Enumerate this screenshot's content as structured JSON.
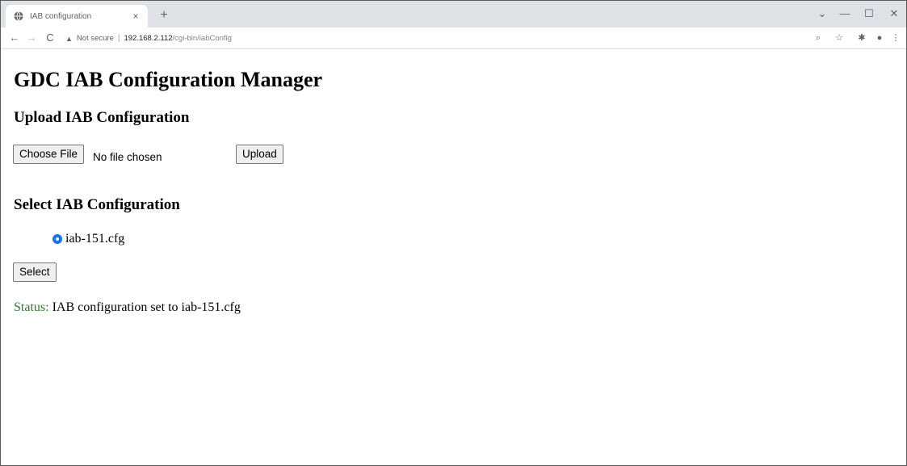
{
  "browser": {
    "tab_title": "IAB configuration",
    "tab_close": "×",
    "new_tab": "+",
    "url_security": "Not secure",
    "url_separator": "|",
    "url_host": "192.168.2.112",
    "url_path": "/cgi-bin/iabConfig",
    "window_controls": {
      "dropdown": "⌄",
      "minimize": "—",
      "maximize": "☐",
      "close": "✕"
    },
    "nav": {
      "back": "←",
      "forward": "→",
      "reload": "C"
    },
    "toolbar_icons": {
      "zoom": "⌕",
      "bookmark": "☆",
      "extensions": "✱",
      "profile": "●",
      "menu": "⋮"
    }
  },
  "page": {
    "title": "GDC IAB Configuration Manager",
    "upload_section": {
      "heading": "Upload IAB Configuration",
      "choose_file_label": "Choose File",
      "file_status": "No file chosen",
      "upload_label": "Upload"
    },
    "select_section": {
      "heading": "Select IAB Configuration",
      "options": [
        {
          "label": "iab-151.cfg",
          "selected": true
        }
      ],
      "select_label": "Select"
    },
    "status": {
      "label": "Status:",
      "message": "IAB configuration set to iab-151.cfg"
    }
  },
  "colors": {
    "status_label": "#2e7d32",
    "radio_accent": "#1a73e8",
    "tabstrip": "#dee1e6"
  }
}
